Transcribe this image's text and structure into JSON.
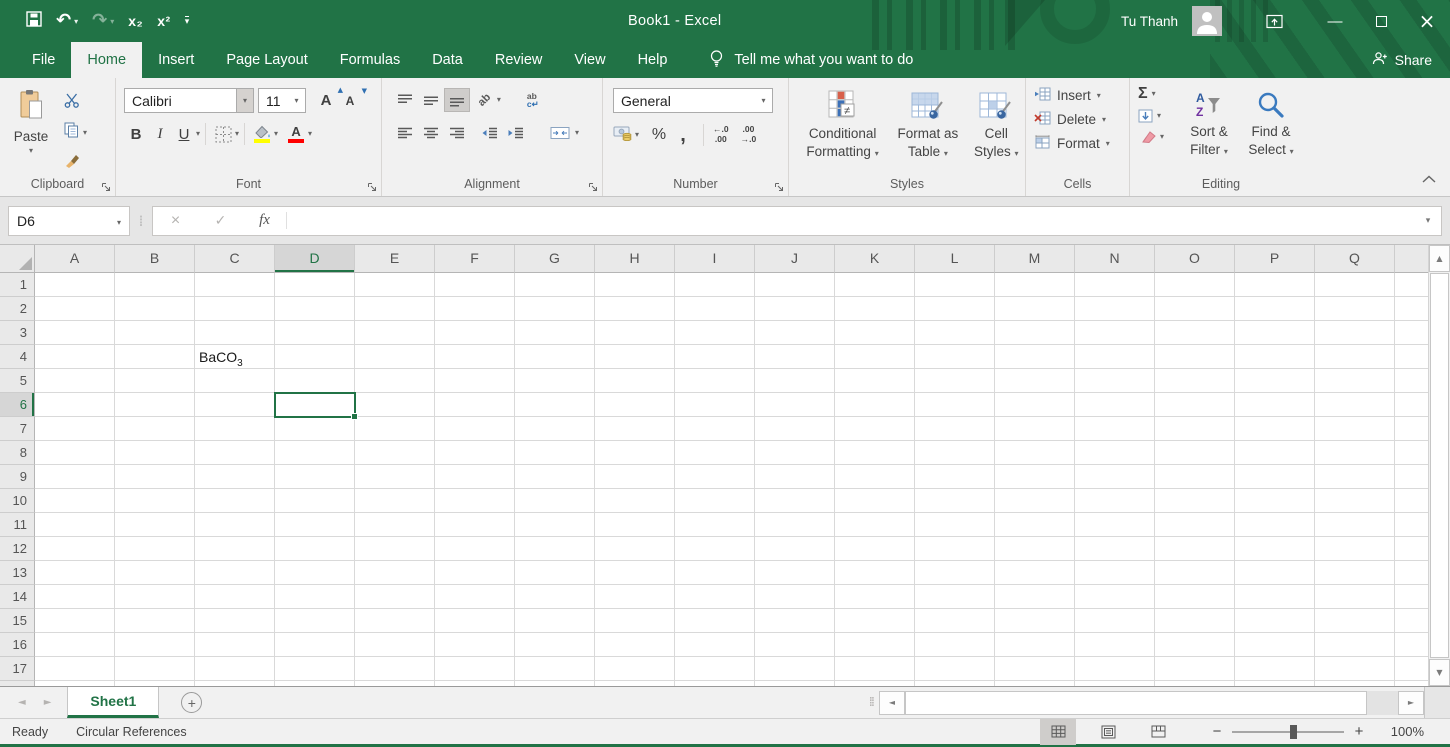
{
  "theme": {
    "accent": "#217346",
    "ribbon_bg": "#f1f1f1",
    "fill_color": "#ffff00",
    "font_color": "#ff0000"
  },
  "icons": {
    "undo": "↶",
    "redo": "↷",
    "dropdown": "▾",
    "minimize": "—",
    "close": "×",
    "up": "▲",
    "down": "▼",
    "left": "◄",
    "right": "►",
    "dots": "⁞⁞",
    "name_sep": "⁞",
    "not_equal": "≠",
    "sort_a": "A",
    "sort_z": "Z",
    "fill_down": "↓",
    "expand": "▾"
  },
  "titlebar": {
    "title": "Book1  -  Excel",
    "user_name": "Tu Thanh",
    "qat": {
      "subscript_label": "x₂",
      "superscript_label": "x²"
    }
  },
  "ribbon_tabs": {
    "items": [
      "File",
      "Home",
      "Insert",
      "Page Layout",
      "Formulas",
      "Data",
      "Review",
      "View",
      "Help"
    ],
    "active": "Home",
    "tell_me": "Tell me what you want to do",
    "share_label": "Share"
  },
  "ribbon": {
    "clipboard": {
      "group_label": "Clipboard",
      "paste_label": "Paste"
    },
    "font": {
      "group_label": "Font",
      "font_name": "Calibri",
      "font_size": "11",
      "bold": "B",
      "italic": "I",
      "underline": "U",
      "increase_font": "A",
      "decrease_font": "A",
      "font_color_a": "A"
    },
    "alignment": {
      "group_label": "Alignment",
      "orientation_text": "ab",
      "wrap_line1": "ab",
      "wrap_line2": "c↵"
    },
    "number": {
      "group_label": "Number",
      "format": "General",
      "percent": "%",
      "comma": ",",
      "inc_decimal": {
        "top": "←.0",
        "bottom": ".00"
      },
      "dec_decimal": {
        "top": ".00",
        "bottom": "→.0"
      }
    },
    "styles": {
      "group_label": "Styles",
      "conditional": [
        "Conditional",
        "Formatting"
      ],
      "format_table": [
        "Format as",
        "Table"
      ],
      "cell_styles": [
        "Cell",
        "Styles"
      ]
    },
    "cells": {
      "group_label": "Cells",
      "insert": "Insert",
      "delete": "Delete",
      "format": "Format"
    },
    "editing": {
      "group_label": "Editing",
      "autosum": "Σ",
      "sort_filter": [
        "Sort &",
        "Filter"
      ],
      "find_select": [
        "Find &",
        "Select"
      ]
    }
  },
  "formula_bar": {
    "name_box": "D6",
    "cancel": "×",
    "enter": "✓",
    "fx": "fx",
    "value": ""
  },
  "grid": {
    "columns": [
      "A",
      "B",
      "C",
      "D",
      "E",
      "F",
      "G",
      "H",
      "I",
      "J",
      "K",
      "L",
      "M",
      "N",
      "O",
      "P",
      "Q"
    ],
    "rows": [
      "1",
      "2",
      "3",
      "4",
      "5",
      "6",
      "7",
      "8",
      "9",
      "10",
      "11",
      "12",
      "13",
      "14",
      "15",
      "16",
      "17"
    ],
    "selected_cell": "D6",
    "selected_column": "D",
    "selected_row": "6",
    "cells": [
      {
        "ref": "C4",
        "text": "BaCO",
        "subscript": "3"
      }
    ]
  },
  "sheet_bar": {
    "active_tab": "Sheet1",
    "add_label": "+"
  },
  "status_bar": {
    "mode": "Ready",
    "message": "Circular References",
    "zoom_out": "−",
    "zoom_in": "+",
    "zoom_level": "100%"
  }
}
